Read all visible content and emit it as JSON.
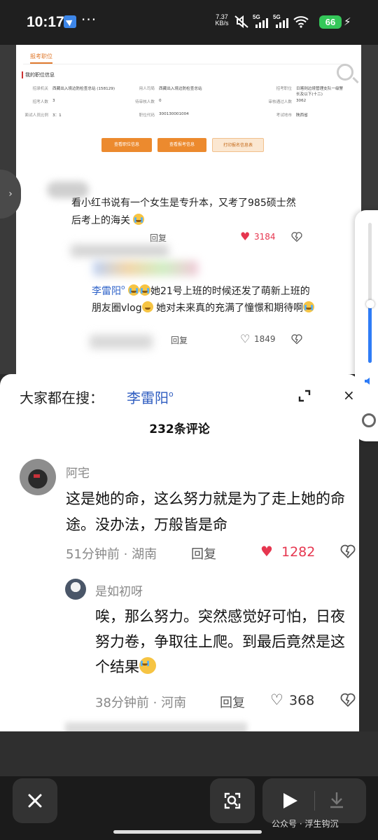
{
  "status_bar": {
    "time": "10:17",
    "dots": "···",
    "net_speed_value": "7.37",
    "net_speed_unit": "KB/s",
    "signal1": "5G",
    "signal2": "5G",
    "battery": "66"
  },
  "document": {
    "tab": "报考职位",
    "section": "我的职位信息",
    "rows": [
      [
        [
          "招录机关",
          "西藏出入境边防检查总站 (158129)"
        ],
        [
          "用人司局",
          "西藏出入境边防检查总站"
        ],
        [
          "招考职位",
          "日喀则边境管理支队一级警长及以下(十二)"
        ]
      ],
      [
        [
          "招考人数",
          "3"
        ],
        [
          "待审核人数",
          "0"
        ],
        [
          "审核通过人数",
          "3062"
        ]
      ],
      [
        [
          "面试人员比例",
          "3：1"
        ],
        [
          "职位代码",
          "300130001004"
        ],
        [
          "考试地市",
          "陕西省"
        ]
      ]
    ],
    "buttons": [
      "查看职位信息",
      "查看报考信息",
      "打印报名信息表"
    ]
  },
  "comments_preview": {
    "c1_text": "看小红书说有一个女生是专升本，又考了985硕士然后考上的海关",
    "c1_reply": "回复",
    "c1_likes": "3184",
    "c2_name": "李雷阳",
    "c2_text": "她21号上班的时候还发了萌新上班的朋友圈vlog",
    "c2_text_b": "她对未来真的充满了憧憬和期待啊",
    "c2_reply": "回复",
    "c2_likes": "1849"
  },
  "sheet": {
    "search_prefix": "大家都在搜：",
    "search_term": "李雷阳",
    "comment_count": "232条评论",
    "comments": [
      {
        "user": "阿宅",
        "text": "这是她的命，这么努力就是为了走上她的命途。没办法，万般皆是命",
        "time_location": "51分钟前 · 湖南",
        "reply": "回复",
        "likes": "1282"
      },
      {
        "user": "是如初呀",
        "text": "唉，那么努力。突然感觉好可怕，日夜努力卷，争取往上爬。到最后竟然是这个结果",
        "time_location": "38分钟前 · 河南",
        "reply": "回复",
        "likes": "368"
      }
    ]
  },
  "watermark": "公众号 · 浮生钩沉",
  "colors": {
    "accent_blue": "#2f5dc0",
    "like_red": "#e6364f",
    "doc_orange": "#ec8a2e"
  }
}
